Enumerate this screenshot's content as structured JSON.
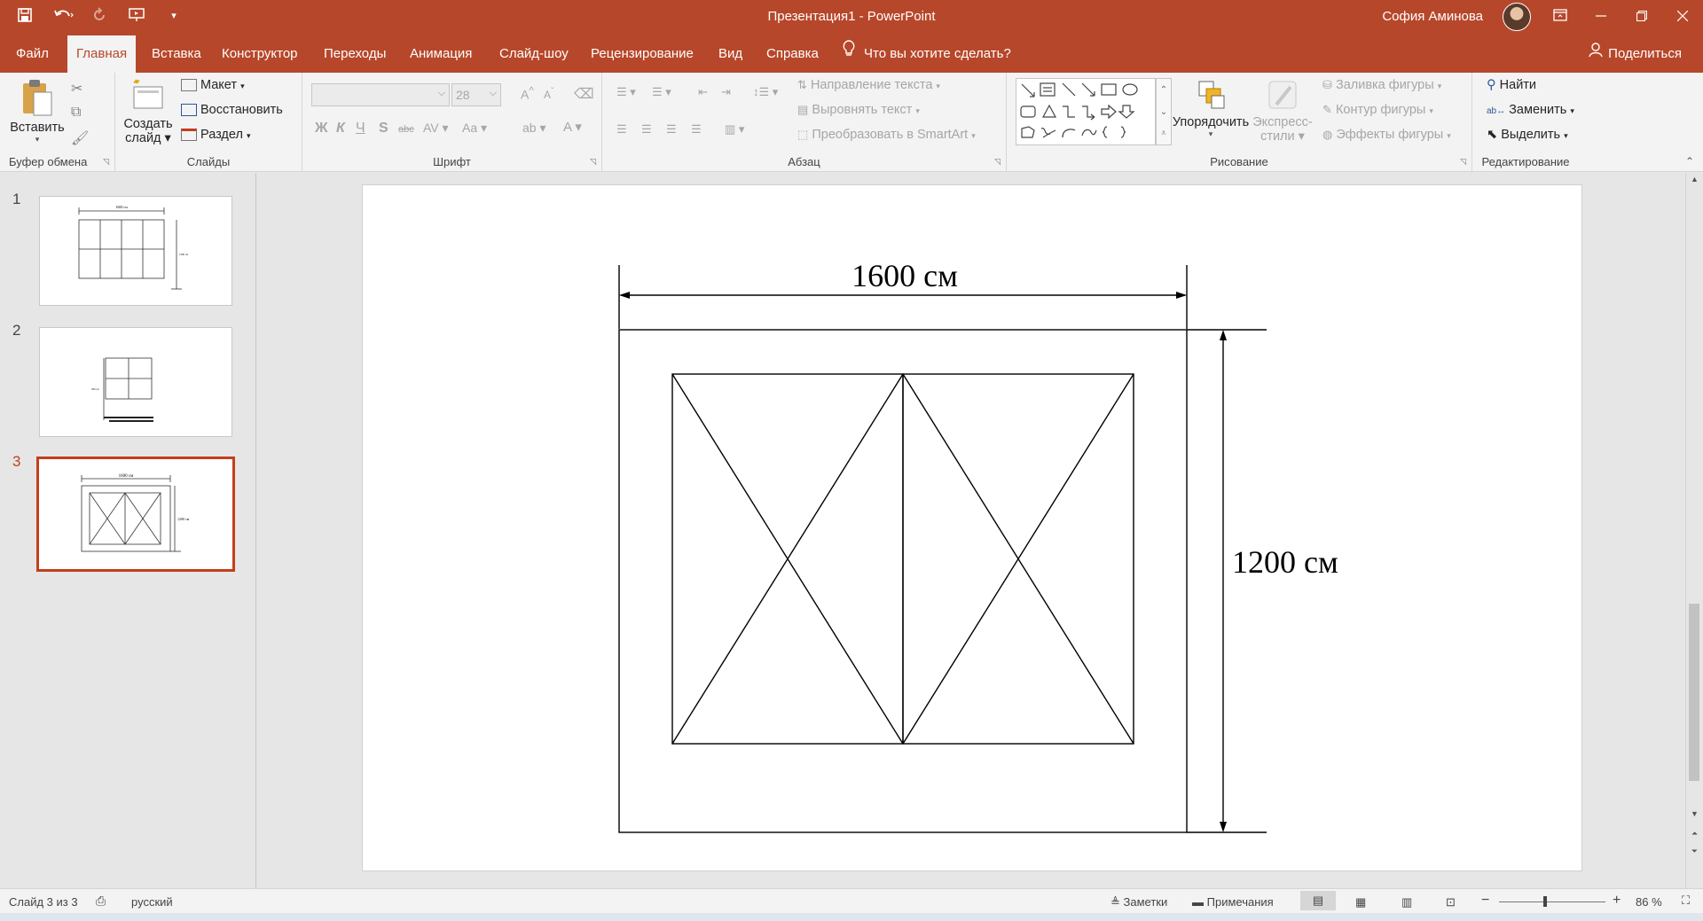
{
  "titlebar": {
    "doc_title": "Презентация1  -  PowerPoint",
    "user": "София Аминова"
  },
  "tabs": [
    "Файл",
    "Главная",
    "Вставка",
    "Конструктор",
    "Переходы",
    "Анимация",
    "Слайд-шоу",
    "Рецензирование",
    "Вид",
    "Справка"
  ],
  "active_tab": "Главная",
  "tell_me": "Что вы хотите сделать?",
  "share": "Поделиться",
  "ribbon": {
    "clipboard": {
      "paste": "Вставить",
      "label": "Буфер обмена"
    },
    "slides": {
      "new_slide_line1": "Создать",
      "new_slide_line2": "слайд",
      "layout": "Макет",
      "reset": "Восстановить",
      "section": "Раздел",
      "label": "Слайды"
    },
    "font": {
      "size": "28",
      "bold": "Ж",
      "italic": "К",
      "underline": "Ч",
      "shadow": "S",
      "strike": "abc",
      "label": "Шрифт"
    },
    "paragraph": {
      "text_direction": "Направление текста",
      "align_text": "Выровнять текст",
      "smartart": "Преобразовать в SmartArt",
      "label": "Абзац"
    },
    "drawing": {
      "arrange": "Упорядочить",
      "quick_styles_line1": "Экспресс-",
      "quick_styles_line2": "стили",
      "fill": "Заливка фигуры",
      "outline": "Контур фигуры",
      "effects": "Эффекты фигуры",
      "label": "Рисование"
    },
    "editing": {
      "find": "Найти",
      "replace": "Заменить",
      "select": "Выделить",
      "label": "Редактирование"
    }
  },
  "slides": [
    {
      "number": "1",
      "selected": false
    },
    {
      "number": "2",
      "selected": false
    },
    {
      "number": "3",
      "selected": true
    }
  ],
  "thumb_labels": {
    "t1_width": "1600 см",
    "t1_height": "1200 см",
    "t2_height": "300 см",
    "t3_width": "1600 см",
    "t3_height": "1200 см"
  },
  "slide": {
    "width_label": "1600 см",
    "height_label": "1200 см"
  },
  "status": {
    "slide_info": "Слайд 3 из 3",
    "language": "русский",
    "notes": "Заметки",
    "comments": "Примечания",
    "zoom": "86 %"
  }
}
